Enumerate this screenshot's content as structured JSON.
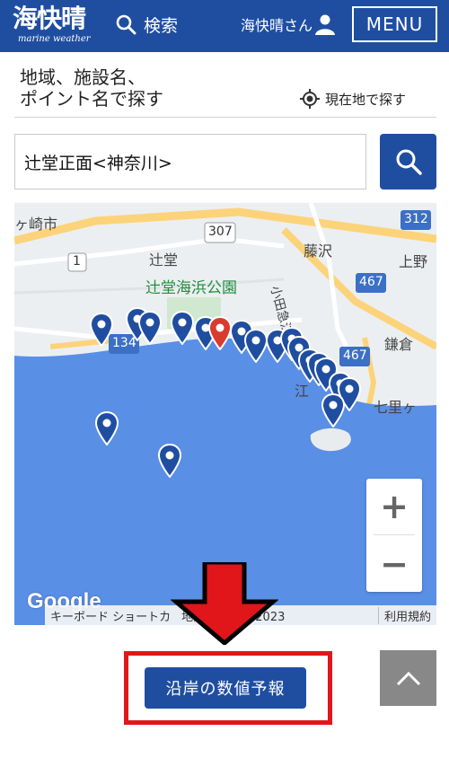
{
  "header": {
    "logo_main": "海快晴",
    "logo_sub": "marine weather",
    "search_label": "検索",
    "user_label": "海快晴さん",
    "menu_label": "MENU"
  },
  "search": {
    "prompt": "地域、施設名、\nポイント名で探す",
    "locate_label": "現在地で探す",
    "value": "辻堂正面<神奈川>"
  },
  "map": {
    "labels": {
      "city_west": "ヶ崎市",
      "tsujido": "辻堂",
      "park": "辻堂海浜公園",
      "fujisawa": "藤沢",
      "line": "小田急江ノ",
      "ueno": "上野",
      "kamakura": "鎌倉",
      "shichiri": "七里ヶ",
      "enoshima": "江"
    },
    "route_badges": [
      "307",
      "312",
      "467",
      "134",
      "467",
      "1"
    ],
    "pin_count": 22,
    "selected_pin_color": "#d93b2f",
    "pin_color": "#1f4ea1",
    "zoom_in": "+",
    "zoom_out": "−",
    "google": "Google",
    "attribution_shortcuts": "キーボード ショートカ",
    "attribution_data": "地図データ ©2023",
    "terms": "利用規約"
  },
  "cta": {
    "label": "沿岸の数値予報"
  },
  "colors": {
    "brand": "#1f4ea1",
    "highlight": "#e0161b",
    "sea": "#5a8fe6"
  }
}
